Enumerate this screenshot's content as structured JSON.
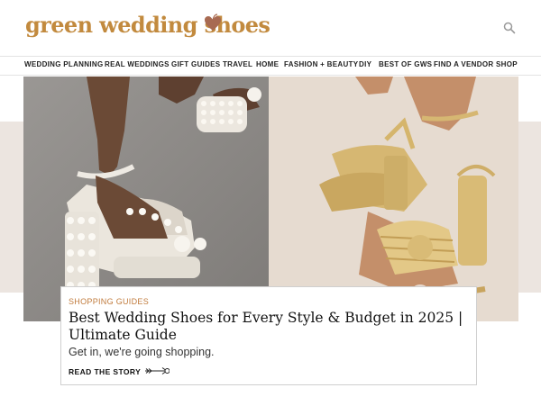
{
  "header": {
    "logo_text": "green wedding shoes",
    "search_icon": "search-icon",
    "heart_icon": "heart-icon",
    "brand_color": "#c28a3e"
  },
  "nav": {
    "items": [
      "WEDDING PLANNING",
      "REAL WEDDINGS",
      "GIFT GUIDES",
      "TRAVEL",
      "HOME",
      "FASHION + BEAUTY",
      "DIY",
      "BEST OF GWS",
      "FIND A VENDOR",
      "SHOP"
    ]
  },
  "featured": {
    "category": "SHOPPING GUIDES",
    "title": "Best Wedding Shoes for Every Style & Budget in 2025 | Ultimate Guide",
    "subtitle": "Get in, we're going shopping.",
    "cta": "READ THE STORY",
    "cta_icon": "arrow-right-icon",
    "category_color": "#c07a3b",
    "band_color": "#ece5e0"
  }
}
